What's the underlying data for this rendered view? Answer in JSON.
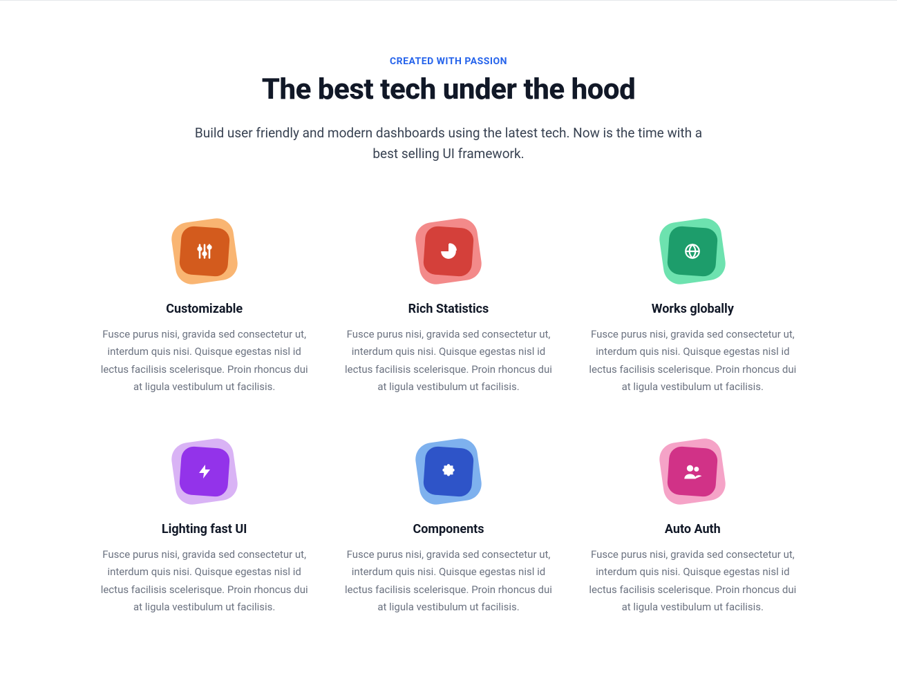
{
  "header": {
    "eyebrow": "CREATED WITH PASSION",
    "headline": "The best tech under the hood",
    "subheadline": "Build user friendly and modern dashboards using the latest tech. Now is the time with a best selling UI framework."
  },
  "features": [
    {
      "icon": "sliders-icon",
      "title": "Customizable",
      "desc": "Fusce purus nisi, gravida sed consectetur ut, interdum quis nisi. Quisque egestas nisl id lectus facilisis scelerisque. Proin rhoncus dui at ligula vestibulum ut facilisis.",
      "blob_color": "#f9b572",
      "box_color": "#d35b1d"
    },
    {
      "icon": "pie-chart-icon",
      "title": "Rich Statistics",
      "desc": "Fusce purus nisi, gravida sed consectetur ut, interdum quis nisi. Quisque egestas nisl id lectus facilisis scelerisque. Proin rhoncus dui at ligula vestibulum ut facilisis.",
      "blob_color": "#f38a8a",
      "box_color": "#d4403a"
    },
    {
      "icon": "globe-icon",
      "title": "Works globally",
      "desc": "Fusce purus nisi, gravida sed consectetur ut, interdum quis nisi. Quisque egestas nisl id lectus facilisis scelerisque. Proin rhoncus dui at ligula vestibulum ut facilisis.",
      "blob_color": "#6de2af",
      "box_color": "#1d9d6b"
    },
    {
      "icon": "bolt-icon",
      "title": "Lighting fast UI",
      "desc": "Fusce purus nisi, gravida sed consectetur ut, interdum quis nisi. Quisque egestas nisl id lectus facilisis scelerisque. Proin rhoncus dui at ligula vestibulum ut facilisis.",
      "blob_color": "#d9b3f5",
      "box_color": "#9333ea"
    },
    {
      "icon": "puzzle-icon",
      "title": "Components",
      "desc": "Fusce purus nisi, gravida sed consectetur ut, interdum quis nisi. Quisque egestas nisl id lectus facilisis scelerisque. Proin rhoncus dui at ligula vestibulum ut facilisis.",
      "blob_color": "#7eb1ee",
      "box_color": "#2e54c8"
    },
    {
      "icon": "users-icon",
      "title": "Auto Auth",
      "desc": "Fusce purus nisi, gravida sed consectetur ut, interdum quis nisi. Quisque egestas nisl id lectus facilisis scelerisque. Proin rhoncus dui at ligula vestibulum ut facilisis.",
      "blob_color": "#f5a3c7",
      "box_color": "#d13287"
    }
  ]
}
